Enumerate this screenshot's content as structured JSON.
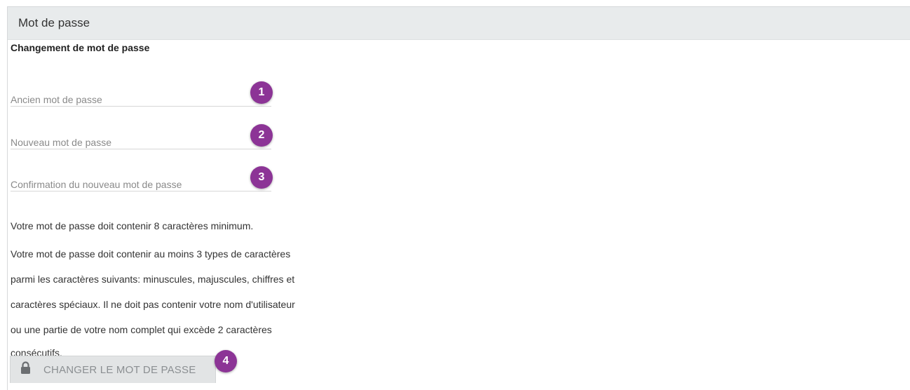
{
  "panel": {
    "title": "Mot de passe"
  },
  "form": {
    "subtitle": "Changement de mot de passe",
    "old_password": {
      "placeholder": "Ancien mot de passe",
      "value": ""
    },
    "new_password": {
      "placeholder": "Nouveau mot de passe",
      "value": ""
    },
    "confirm_password": {
      "placeholder": "Confirmation du nouveau mot de passe",
      "value": ""
    },
    "rules": [
      "Votre mot de passe doit contenir 8 caractères minimum.",
      "Votre mot de passe doit contenir au moins 3 types de caractères",
      "parmi les caractères suivants: minuscules, majuscules, chiffres et",
      "caractères spéciaux. Il ne doit pas contenir votre nom d'utilisateur",
      "ou une partie de votre nom complet qui excède 2 caractères",
      "consécutifs."
    ],
    "submit": {
      "label": "CHANGER LE MOT DE PASSE",
      "icon": "lock-icon",
      "disabled": true
    }
  },
  "badges": [
    "1",
    "2",
    "3",
    "4"
  ],
  "colors": {
    "badge": "#8c3496",
    "header_bg": "#e8ebec",
    "button_bg": "#e2e4e5"
  }
}
